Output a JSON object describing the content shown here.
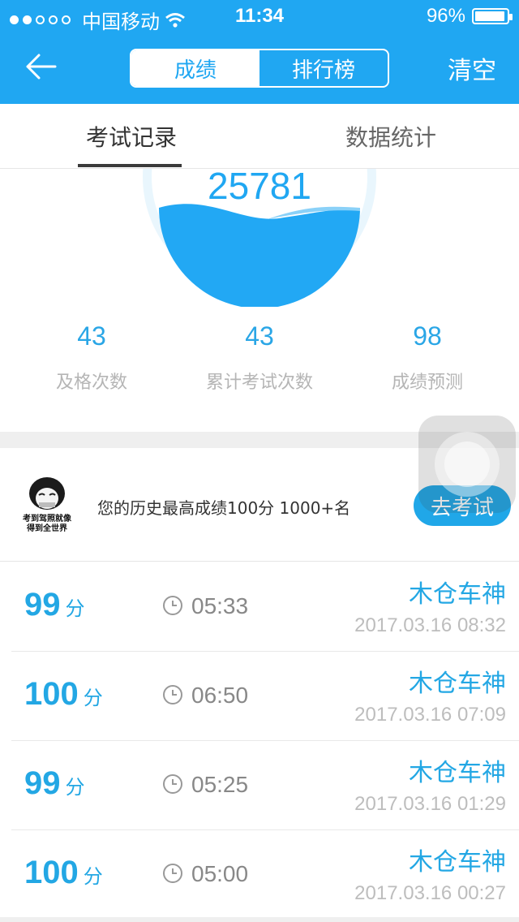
{
  "status_bar": {
    "carrier": "中国移动",
    "time": "11:34",
    "battery": "96%"
  },
  "nav": {
    "segments": [
      "成绩",
      "排行榜"
    ],
    "active_segment": "成绩",
    "right_action": "清空"
  },
  "tabs": [
    "考试记录",
    "数据统计"
  ],
  "summary": {
    "score": "25781",
    "stats": [
      {
        "value": "43",
        "label": "及格次数"
      },
      {
        "value": "43",
        "label": "累计考试次数"
      },
      {
        "value": "98",
        "label": "成绩预测"
      }
    ]
  },
  "best": {
    "avatar_caption_line1": "考到驾照就像",
    "avatar_caption_line2": "得到全世界",
    "text": "您的历史最高成绩100分  1000+名",
    "button": "去考试"
  },
  "records": [
    {
      "score": "99",
      "unit": "分",
      "duration": "05:33",
      "user": "木仓车神",
      "date": "2017.03.16 08:32"
    },
    {
      "score": "100",
      "unit": "分",
      "duration": "06:50",
      "user": "木仓车神",
      "date": "2017.03.16 07:09"
    },
    {
      "score": "99",
      "unit": "分",
      "duration": "05:25",
      "user": "木仓车神",
      "date": "2017.03.16 01:29"
    },
    {
      "score": "100",
      "unit": "分",
      "duration": "05:00",
      "user": "木仓车神",
      "date": "2017.03.16 00:27"
    }
  ],
  "colors": {
    "primary": "#20a7f2",
    "accent_text": "#23a7e4",
    "muted": "#bdbdbd"
  }
}
